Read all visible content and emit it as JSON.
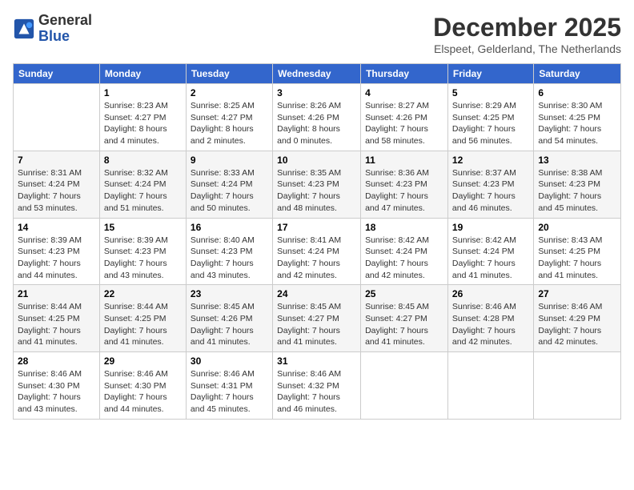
{
  "logo": {
    "general": "General",
    "blue": "Blue"
  },
  "title": "December 2025",
  "location": "Elspeet, Gelderland, The Netherlands",
  "weekdays": [
    "Sunday",
    "Monday",
    "Tuesday",
    "Wednesday",
    "Thursday",
    "Friday",
    "Saturday"
  ],
  "weeks": [
    [
      {
        "day": "",
        "sunrise": "",
        "sunset": "",
        "daylight": ""
      },
      {
        "day": "1",
        "sunrise": "Sunrise: 8:23 AM",
        "sunset": "Sunset: 4:27 PM",
        "daylight": "Daylight: 8 hours and 4 minutes."
      },
      {
        "day": "2",
        "sunrise": "Sunrise: 8:25 AM",
        "sunset": "Sunset: 4:27 PM",
        "daylight": "Daylight: 8 hours and 2 minutes."
      },
      {
        "day": "3",
        "sunrise": "Sunrise: 8:26 AM",
        "sunset": "Sunset: 4:26 PM",
        "daylight": "Daylight: 8 hours and 0 minutes."
      },
      {
        "day": "4",
        "sunrise": "Sunrise: 8:27 AM",
        "sunset": "Sunset: 4:26 PM",
        "daylight": "Daylight: 7 hours and 58 minutes."
      },
      {
        "day": "5",
        "sunrise": "Sunrise: 8:29 AM",
        "sunset": "Sunset: 4:25 PM",
        "daylight": "Daylight: 7 hours and 56 minutes."
      },
      {
        "day": "6",
        "sunrise": "Sunrise: 8:30 AM",
        "sunset": "Sunset: 4:25 PM",
        "daylight": "Daylight: 7 hours and 54 minutes."
      }
    ],
    [
      {
        "day": "7",
        "sunrise": "Sunrise: 8:31 AM",
        "sunset": "Sunset: 4:24 PM",
        "daylight": "Daylight: 7 hours and 53 minutes."
      },
      {
        "day": "8",
        "sunrise": "Sunrise: 8:32 AM",
        "sunset": "Sunset: 4:24 PM",
        "daylight": "Daylight: 7 hours and 51 minutes."
      },
      {
        "day": "9",
        "sunrise": "Sunrise: 8:33 AM",
        "sunset": "Sunset: 4:24 PM",
        "daylight": "Daylight: 7 hours and 50 minutes."
      },
      {
        "day": "10",
        "sunrise": "Sunrise: 8:35 AM",
        "sunset": "Sunset: 4:23 PM",
        "daylight": "Daylight: 7 hours and 48 minutes."
      },
      {
        "day": "11",
        "sunrise": "Sunrise: 8:36 AM",
        "sunset": "Sunset: 4:23 PM",
        "daylight": "Daylight: 7 hours and 47 minutes."
      },
      {
        "day": "12",
        "sunrise": "Sunrise: 8:37 AM",
        "sunset": "Sunset: 4:23 PM",
        "daylight": "Daylight: 7 hours and 46 minutes."
      },
      {
        "day": "13",
        "sunrise": "Sunrise: 8:38 AM",
        "sunset": "Sunset: 4:23 PM",
        "daylight": "Daylight: 7 hours and 45 minutes."
      }
    ],
    [
      {
        "day": "14",
        "sunrise": "Sunrise: 8:39 AM",
        "sunset": "Sunset: 4:23 PM",
        "daylight": "Daylight: 7 hours and 44 minutes."
      },
      {
        "day": "15",
        "sunrise": "Sunrise: 8:39 AM",
        "sunset": "Sunset: 4:23 PM",
        "daylight": "Daylight: 7 hours and 43 minutes."
      },
      {
        "day": "16",
        "sunrise": "Sunrise: 8:40 AM",
        "sunset": "Sunset: 4:23 PM",
        "daylight": "Daylight: 7 hours and 43 minutes."
      },
      {
        "day": "17",
        "sunrise": "Sunrise: 8:41 AM",
        "sunset": "Sunset: 4:24 PM",
        "daylight": "Daylight: 7 hours and 42 minutes."
      },
      {
        "day": "18",
        "sunrise": "Sunrise: 8:42 AM",
        "sunset": "Sunset: 4:24 PM",
        "daylight": "Daylight: 7 hours and 42 minutes."
      },
      {
        "day": "19",
        "sunrise": "Sunrise: 8:42 AM",
        "sunset": "Sunset: 4:24 PM",
        "daylight": "Daylight: 7 hours and 41 minutes."
      },
      {
        "day": "20",
        "sunrise": "Sunrise: 8:43 AM",
        "sunset": "Sunset: 4:25 PM",
        "daylight": "Daylight: 7 hours and 41 minutes."
      }
    ],
    [
      {
        "day": "21",
        "sunrise": "Sunrise: 8:44 AM",
        "sunset": "Sunset: 4:25 PM",
        "daylight": "Daylight: 7 hours and 41 minutes."
      },
      {
        "day": "22",
        "sunrise": "Sunrise: 8:44 AM",
        "sunset": "Sunset: 4:25 PM",
        "daylight": "Daylight: 7 hours and 41 minutes."
      },
      {
        "day": "23",
        "sunrise": "Sunrise: 8:45 AM",
        "sunset": "Sunset: 4:26 PM",
        "daylight": "Daylight: 7 hours and 41 minutes."
      },
      {
        "day": "24",
        "sunrise": "Sunrise: 8:45 AM",
        "sunset": "Sunset: 4:27 PM",
        "daylight": "Daylight: 7 hours and 41 minutes."
      },
      {
        "day": "25",
        "sunrise": "Sunrise: 8:45 AM",
        "sunset": "Sunset: 4:27 PM",
        "daylight": "Daylight: 7 hours and 41 minutes."
      },
      {
        "day": "26",
        "sunrise": "Sunrise: 8:46 AM",
        "sunset": "Sunset: 4:28 PM",
        "daylight": "Daylight: 7 hours and 42 minutes."
      },
      {
        "day": "27",
        "sunrise": "Sunrise: 8:46 AM",
        "sunset": "Sunset: 4:29 PM",
        "daylight": "Daylight: 7 hours and 42 minutes."
      }
    ],
    [
      {
        "day": "28",
        "sunrise": "Sunrise: 8:46 AM",
        "sunset": "Sunset: 4:30 PM",
        "daylight": "Daylight: 7 hours and 43 minutes."
      },
      {
        "day": "29",
        "sunrise": "Sunrise: 8:46 AM",
        "sunset": "Sunset: 4:30 PM",
        "daylight": "Daylight: 7 hours and 44 minutes."
      },
      {
        "day": "30",
        "sunrise": "Sunrise: 8:46 AM",
        "sunset": "Sunset: 4:31 PM",
        "daylight": "Daylight: 7 hours and 45 minutes."
      },
      {
        "day": "31",
        "sunrise": "Sunrise: 8:46 AM",
        "sunset": "Sunset: 4:32 PM",
        "daylight": "Daylight: 7 hours and 46 minutes."
      },
      {
        "day": "",
        "sunrise": "",
        "sunset": "",
        "daylight": ""
      },
      {
        "day": "",
        "sunrise": "",
        "sunset": "",
        "daylight": ""
      },
      {
        "day": "",
        "sunrise": "",
        "sunset": "",
        "daylight": ""
      }
    ]
  ]
}
